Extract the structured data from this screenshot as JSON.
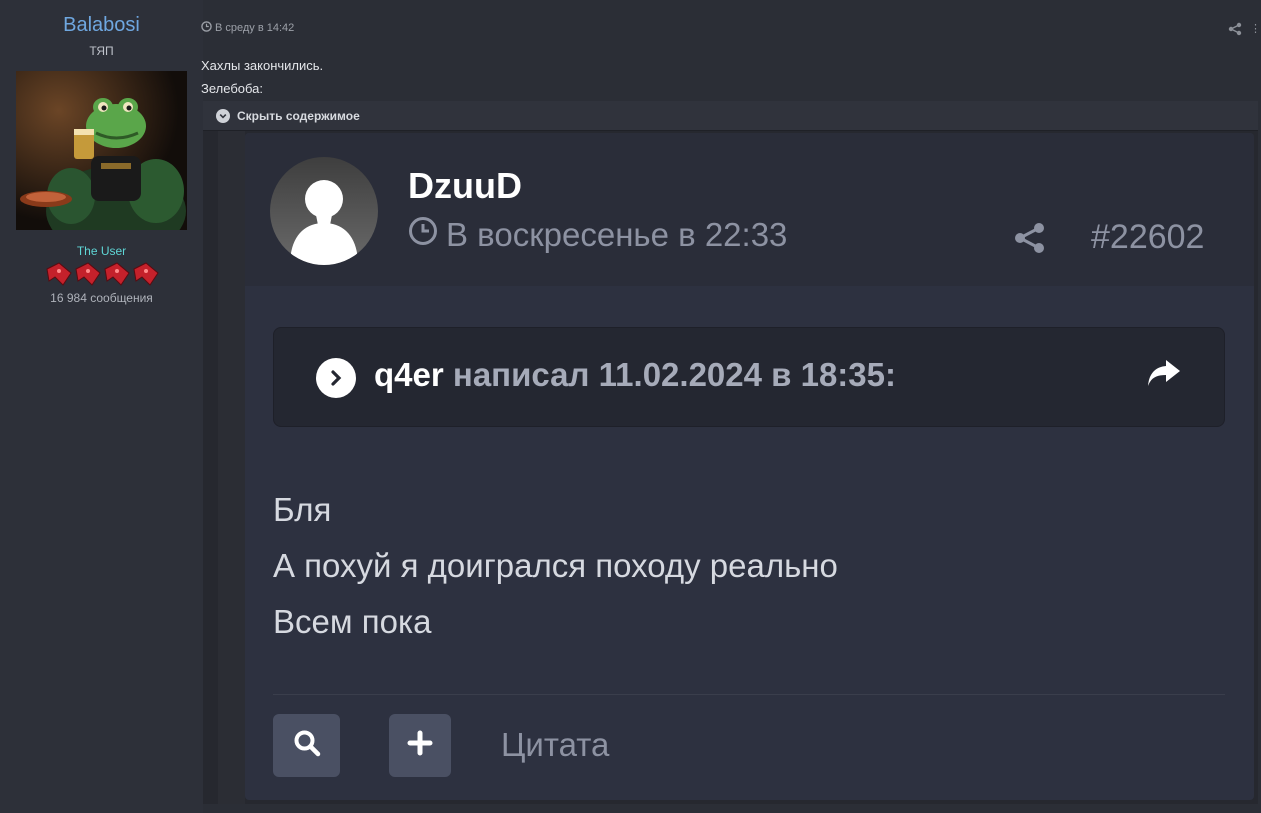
{
  "author": {
    "username": "Balabosi",
    "title": "ТЯП",
    "role": "The User",
    "message_count": "16 984 сообщения"
  },
  "post": {
    "timestamp": "В среду в 14:42",
    "lines": [
      "Хахлы закончились.",
      "Зелебоба:"
    ],
    "spoiler_label": "Скрыть содержимое"
  },
  "embedded": {
    "username": "DzuuD",
    "timestamp": "В воскресенье в 22:33",
    "post_number": "#22602",
    "quote": {
      "author": "q4er",
      "text": "написал 11.02.2024 в 18:35:"
    },
    "message_lines": [
      "Бля",
      "А похуй я доигрался походу реально",
      "Всем пока"
    ],
    "quote_button_label": "Цитата"
  },
  "colors": {
    "username": "#6fa7e0",
    "role": "#5fd6d6",
    "background": "#2b2e36",
    "embedded_bg": "#2d3140"
  }
}
